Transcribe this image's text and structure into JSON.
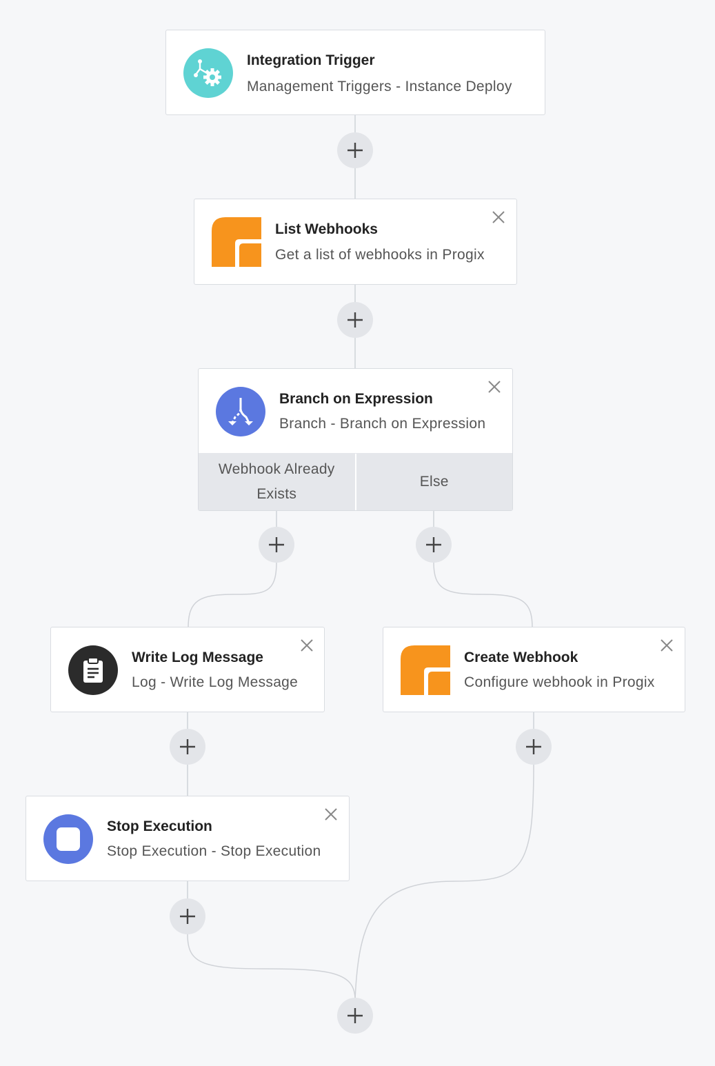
{
  "steps": {
    "trigger": {
      "title": "Integration Trigger",
      "subtitle": "Management Triggers - Instance Deploy",
      "icon": "integration-trigger-icon",
      "color": "#5fd3d3"
    },
    "list_webhooks": {
      "title": "List Webhooks",
      "subtitle": "Get a list of webhooks in Progix",
      "icon": "progix-logo-icon",
      "color": "#f7941d"
    },
    "branch": {
      "title": "Branch on Expression",
      "subtitle": "Branch - Branch on Expression",
      "icon": "branch-icon",
      "color": "#5b78e0",
      "branches": [
        "Webhook Already Exists",
        "Else"
      ]
    },
    "write_log": {
      "title": "Write Log Message",
      "subtitle": "Log - Write Log Message",
      "icon": "clipboard-icon",
      "color": "#2b2b2b"
    },
    "create_webhook": {
      "title": "Create Webhook",
      "subtitle": "Configure webhook in Progix",
      "icon": "progix-logo-icon",
      "color": "#f7941d"
    },
    "stop": {
      "title": "Stop Execution",
      "subtitle": "Stop Execution - Stop Execution",
      "icon": "stop-icon",
      "color": "#5b78e0"
    }
  },
  "colors": {
    "background": "#f6f7f9",
    "connector": "#cfd2d7",
    "add_button": "#e3e5e9"
  }
}
